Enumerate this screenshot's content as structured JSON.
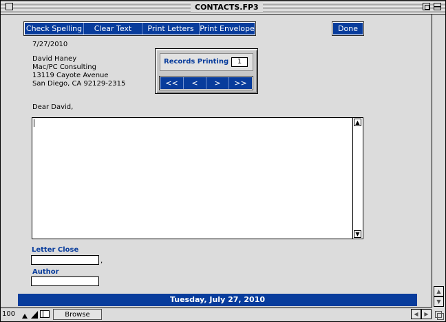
{
  "window": {
    "title": "CONTACTS.FP3"
  },
  "toolbar": {
    "check_spelling": "Check Spelling",
    "clear_text": "Clear Text",
    "print_letters": "Print Letters",
    "print_envelope": "Print Envelope",
    "done": "Done"
  },
  "letter": {
    "date": "7/27/2010",
    "address": [
      "David Haney",
      "Mac/PC Consulting",
      "13119 Cayote Avenue",
      "San Diego, CA 92129-2315"
    ],
    "salutation": "Dear David,",
    "body": "",
    "close_label": "Letter Close",
    "close_value": "",
    "close_comma": ",",
    "author_label": "Author",
    "author_value": ""
  },
  "records_panel": {
    "label": "Records Printing",
    "value": "1",
    "nav": [
      "<<",
      "<",
      ">",
      ">>"
    ]
  },
  "footer": {
    "date": "Tuesday, July 27, 2010"
  },
  "status": {
    "zoom": "100",
    "mode": "Browse"
  }
}
